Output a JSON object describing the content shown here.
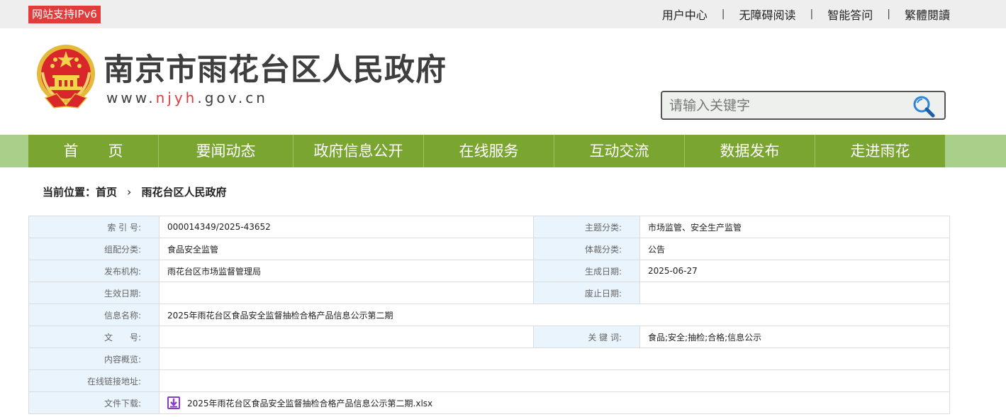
{
  "topbar": {
    "ipv6_badge": "网站支持IPv6",
    "links": [
      "用户中心",
      "无障碍阅读",
      "智能答问",
      "繁體閱讀"
    ],
    "separator": "|"
  },
  "header": {
    "site_name": "南京市雨花台区人民政府",
    "url_prefix": "www.",
    "url_highlight": "njyh",
    "url_suffix": ".gov.cn",
    "emblem_icon": "national-emblem-icon"
  },
  "search": {
    "placeholder": "请输入关键字",
    "icon": "search-icon"
  },
  "nav": {
    "items": [
      "首　　页",
      "要闻动态",
      "政府信息公开",
      "在线服务",
      "互动交流",
      "数据发布",
      "走进雨花"
    ]
  },
  "breadcrumb": {
    "prefix": "当前位置：",
    "home": "首页",
    "chevron": "›",
    "current": "雨花台区人民政府"
  },
  "info": {
    "index_label": "索 引 号:",
    "index_value": "000014349/2025-43652",
    "topic_label": "主题分类:",
    "topic_value": "市场监管、安全生产监管",
    "group_label": "组配分类:",
    "group_value": "食品安全监管",
    "genre_label": "体裁分类:",
    "genre_value": "公告",
    "publisher_label": "发布机构:",
    "publisher_value": "雨花台区市场监督管理局",
    "created_label": "生成日期:",
    "created_value": "2025-06-27",
    "effective_label": "生效日期:",
    "effective_value": "",
    "abolished_label": "废止日期:",
    "abolished_value": "",
    "name_label": "信息名称:",
    "name_value": "2025年雨花台区食品安全监督抽检合格产品信息公示第二期",
    "docno_label": "文　　号:",
    "docno_value": "",
    "keywords_label": "关 键 词:",
    "keywords_value": "食品;安全;抽检;合格;信息公示",
    "summary_label": "内容概览:",
    "summary_value": "",
    "link_label": "在线链接地址:",
    "link_value": "",
    "download_label": "文件下载:",
    "download_file": "2025年雨花台区食品安全监督抽检合格产品信息公示第二期.xlsx",
    "download_icon": "download-icon"
  },
  "colors": {
    "nav_green": "#7aa531",
    "nav_band": "#a9d08b",
    "badge_red": "#e03c3c",
    "label_bg": "#eaf4fc",
    "download_purple": "#8a3cc8"
  }
}
